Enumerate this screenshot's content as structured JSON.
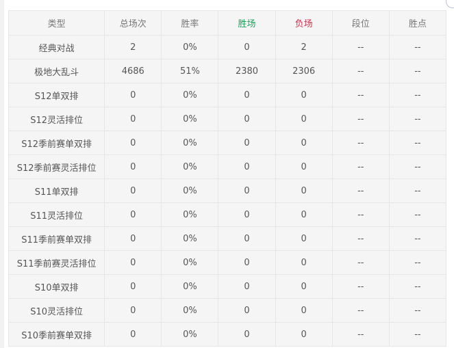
{
  "colors": {
    "wins_header": "#18a058",
    "losses_header": "#d03050"
  },
  "table": {
    "headers": {
      "type": "类型",
      "total": "总场次",
      "winrate": "胜率",
      "wins": "胜场",
      "losses": "负场",
      "tier": "段位",
      "lp": "胜点"
    },
    "rows": [
      {
        "type": "经典对战",
        "total": "2",
        "winrate": "0%",
        "wins": "0",
        "losses": "2",
        "tier": "--",
        "lp": "--"
      },
      {
        "type": "极地大乱斗",
        "total": "4686",
        "winrate": "51%",
        "wins": "2380",
        "losses": "2306",
        "tier": "--",
        "lp": "--"
      },
      {
        "type": "S12单双排",
        "total": "0",
        "winrate": "0%",
        "wins": "0",
        "losses": "0",
        "tier": "--",
        "lp": "--"
      },
      {
        "type": "S12灵活排位",
        "total": "0",
        "winrate": "0%",
        "wins": "0",
        "losses": "0",
        "tier": "--",
        "lp": "--"
      },
      {
        "type": "S12季前赛单双排",
        "total": "0",
        "winrate": "0%",
        "wins": "0",
        "losses": "0",
        "tier": "--",
        "lp": "--"
      },
      {
        "type": "S12季前赛灵活排位",
        "total": "0",
        "winrate": "0%",
        "wins": "0",
        "losses": "0",
        "tier": "--",
        "lp": "--"
      },
      {
        "type": "S11单双排",
        "total": "0",
        "winrate": "0%",
        "wins": "0",
        "losses": "0",
        "tier": "--",
        "lp": "--"
      },
      {
        "type": "S11灵活排位",
        "total": "0",
        "winrate": "0%",
        "wins": "0",
        "losses": "0",
        "tier": "--",
        "lp": "--"
      },
      {
        "type": "S11季前赛单双排",
        "total": "0",
        "winrate": "0%",
        "wins": "0",
        "losses": "0",
        "tier": "--",
        "lp": "--"
      },
      {
        "type": "S11季前赛灵活排位",
        "total": "0",
        "winrate": "0%",
        "wins": "0",
        "losses": "0",
        "tier": "--",
        "lp": "--"
      },
      {
        "type": "S10单双排",
        "total": "0",
        "winrate": "0%",
        "wins": "0",
        "losses": "0",
        "tier": "--",
        "lp": "--"
      },
      {
        "type": "S10灵活排位",
        "total": "0",
        "winrate": "0%",
        "wins": "0",
        "losses": "0",
        "tier": "--",
        "lp": "--"
      },
      {
        "type": "S10季前赛单双排",
        "total": "0",
        "winrate": "0%",
        "wins": "0",
        "losses": "0",
        "tier": "--",
        "lp": "--"
      }
    ]
  }
}
